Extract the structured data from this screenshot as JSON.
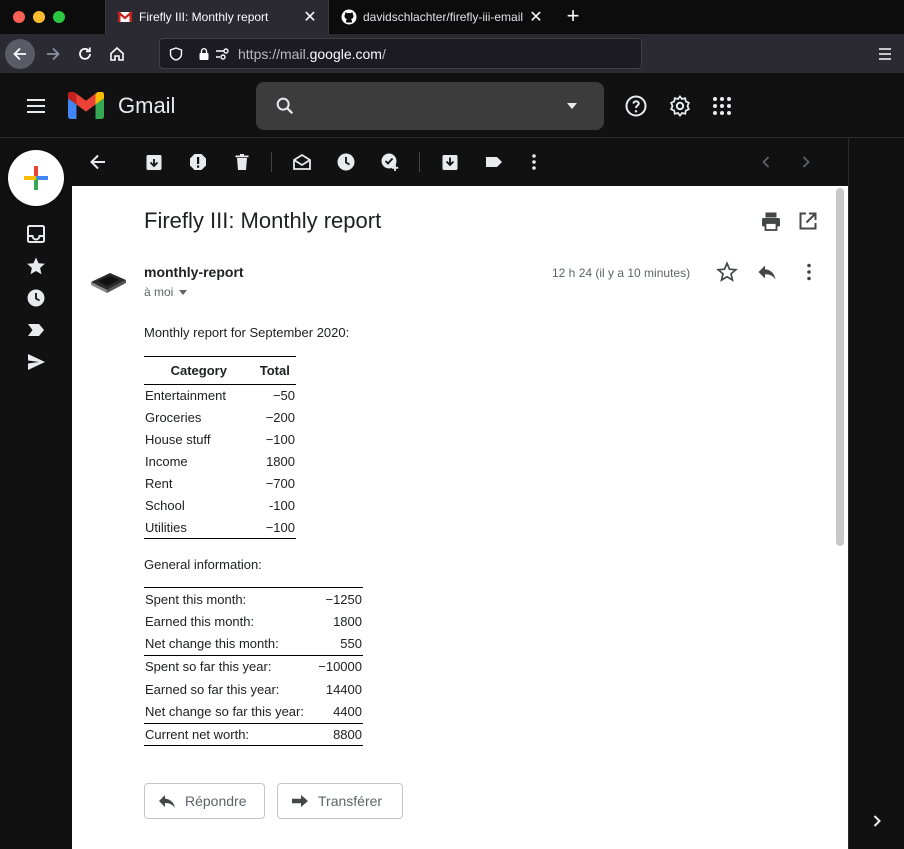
{
  "browser": {
    "tabs": [
      {
        "title": "Firefly III: Monthly report",
        "favicon": "gmail-icon",
        "active": true
      },
      {
        "title": "davidschlachter/firefly-iii-email",
        "favicon": "github-icon",
        "active": false
      }
    ],
    "url": {
      "prefix": "https://mail.",
      "domain": "google.com",
      "suffix": "/"
    }
  },
  "gmail": {
    "product_name": "Gmail",
    "search_placeholder": ""
  },
  "message": {
    "subject": "Firefly III: Monthly report",
    "sender": "monthly-report",
    "recipient": "à moi",
    "timestamp": "12 h 24 (il y a 10 minutes)",
    "intro": "Monthly report for September 2020:",
    "category_table": {
      "headers": [
        "Category",
        "Total"
      ],
      "rows": [
        {
          "category": "Entertainment",
          "total": "−50"
        },
        {
          "category": "Groceries",
          "total": "−200"
        },
        {
          "category": "House stuff",
          "total": "−100"
        },
        {
          "category": "Income",
          "total": "1800"
        },
        {
          "category": "Rent",
          "total": "−700"
        },
        {
          "category": "School",
          "total": "-100"
        },
        {
          "category": "Utilities",
          "total": "−100"
        }
      ]
    },
    "general_heading": "General information:",
    "general_table": {
      "rows": [
        {
          "label": "Spent this month:",
          "value": "−1250"
        },
        {
          "label": "Earned this month:",
          "value": "1800"
        },
        {
          "label": "Net change this month:",
          "value": "550"
        },
        {
          "label": "Spent so far this year:",
          "value": "−10000"
        },
        {
          "label": "Earned so far this year:",
          "value": "14400"
        },
        {
          "label": "Net change so far this year:",
          "value": "4400"
        },
        {
          "label": "Current net worth:",
          "value": "8800"
        }
      ]
    },
    "actions": {
      "reply": "Répondre",
      "forward": "Transférer"
    }
  },
  "colors": {
    "accent_red": "#ea4335",
    "compose_blue": "#4285f4",
    "compose_green": "#34a853",
    "compose_yellow": "#fbbc04"
  }
}
